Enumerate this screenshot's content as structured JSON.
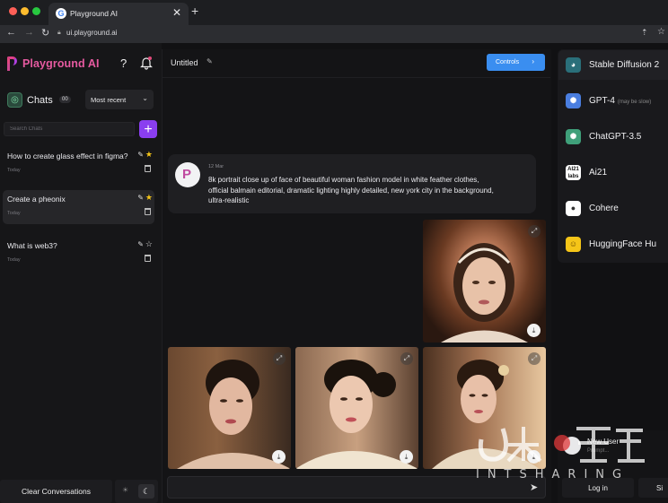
{
  "browser": {
    "tab_title": "Playground AI",
    "url": "ui.playground.ai"
  },
  "brand": {
    "name": "Playground AI",
    "accent": "#e65aa0"
  },
  "sidebar": {
    "chats_label": "Chats",
    "chats_count": "00",
    "sort_value": "Most recent",
    "search_placeholder": "Search Chats",
    "items": [
      {
        "title": "How to create glass effect in figma?",
        "date": "Today",
        "starred": true
      },
      {
        "title": "Create a pheonix",
        "date": "Today",
        "starred": true,
        "active": true
      },
      {
        "title": "What is web3?",
        "date": "Today",
        "starred": false
      }
    ],
    "clear_label": "Clear Conversations"
  },
  "main": {
    "title": "Untitled",
    "controls_label": "Controls",
    "message": {
      "date": "12 Mar",
      "text": "8k portrait close up of face of beautiful woman fashion model in white feather clothes, official balmain editorial, dramatic lighting highly detailed, new york city in the background, ultra-realistic"
    },
    "prompt_placeholder": ""
  },
  "models": [
    {
      "name": "Stable Diffusion 2",
      "note": "",
      "icon": "palette-icon",
      "color": "#2a6f7a"
    },
    {
      "name": "GPT-4",
      "note": "(may be slow)",
      "icon": "openai-icon",
      "color": "#4a7ee0"
    },
    {
      "name": "ChatGPT-3.5",
      "note": "",
      "icon": "openai-icon",
      "color": "#3fa07a"
    },
    {
      "name": "Ai21",
      "note": "",
      "icon": "ai21-icon",
      "color": "#ffffff"
    },
    {
      "name": "Cohere",
      "note": "",
      "icon": "cohere-icon",
      "color": "#ffffff"
    },
    {
      "name": "HuggingFace Hu",
      "note": "",
      "icon": "hugging-face-icon",
      "color": "#f5c518"
    }
  ],
  "user": {
    "name": "New User",
    "sub": "Prompt...",
    "login_label": "Log in",
    "signup_label": "Si"
  },
  "watermark": {
    "text": "INTSHARING"
  }
}
